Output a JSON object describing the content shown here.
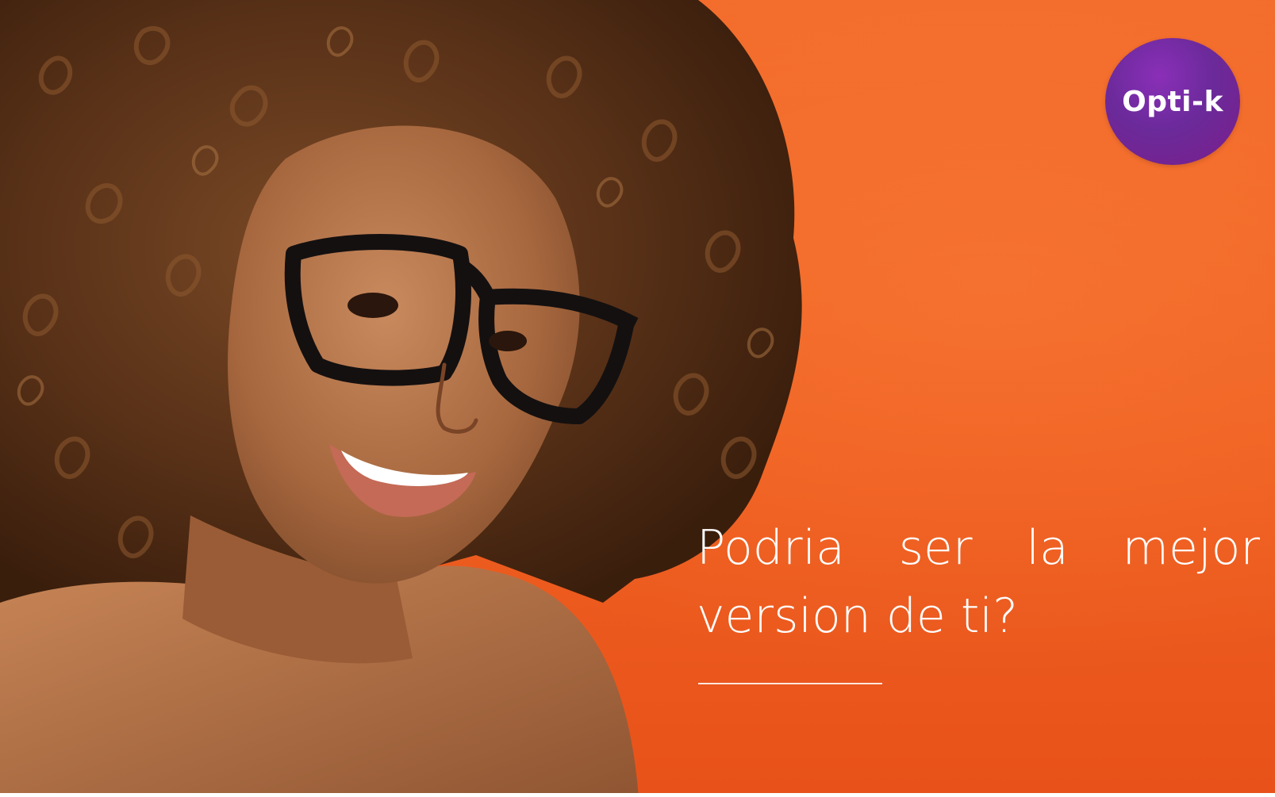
{
  "brand": {
    "logo_text": "Opti-k"
  },
  "hero": {
    "headline_line1_words": [
      "Podria",
      "ser",
      "la",
      "mejor"
    ],
    "headline_line2": "version de ti?"
  },
  "colors": {
    "background": "#ef5f20",
    "logo_badge": "#6b2a9a",
    "headline_text": "#ffffff"
  },
  "image": {
    "subject": "smiling woman with curly hair wearing black eyeglasses"
  }
}
